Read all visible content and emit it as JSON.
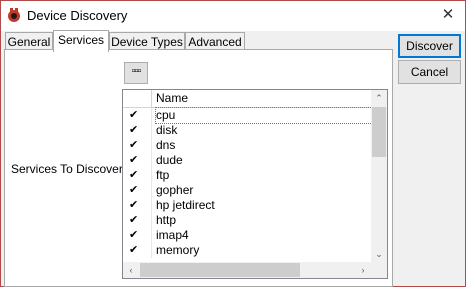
{
  "window": {
    "title": "Device Discovery",
    "close_glyph": "✕"
  },
  "tabs": [
    {
      "label": "General",
      "active": false
    },
    {
      "label": "Services",
      "active": true
    },
    {
      "label": "Device Types",
      "active": false
    },
    {
      "label": "Advanced",
      "active": false
    }
  ],
  "services": {
    "field_label": "Services To Discover:",
    "more_button": "▫▫▫",
    "column_name": "Name",
    "rows": [
      {
        "checked": true,
        "name": "cpu"
      },
      {
        "checked": true,
        "name": "disk"
      },
      {
        "checked": true,
        "name": "dns"
      },
      {
        "checked": true,
        "name": "dude"
      },
      {
        "checked": true,
        "name": "ftp"
      },
      {
        "checked": true,
        "name": "gopher"
      },
      {
        "checked": true,
        "name": "hp jetdirect"
      },
      {
        "checked": true,
        "name": "http"
      },
      {
        "checked": true,
        "name": "imap4"
      },
      {
        "checked": true,
        "name": "memory"
      }
    ]
  },
  "buttons": {
    "discover": "Discover",
    "cancel": "Cancel"
  },
  "icons": {
    "title_icon": "dude-app-icon",
    "check_glyph": "✔"
  }
}
